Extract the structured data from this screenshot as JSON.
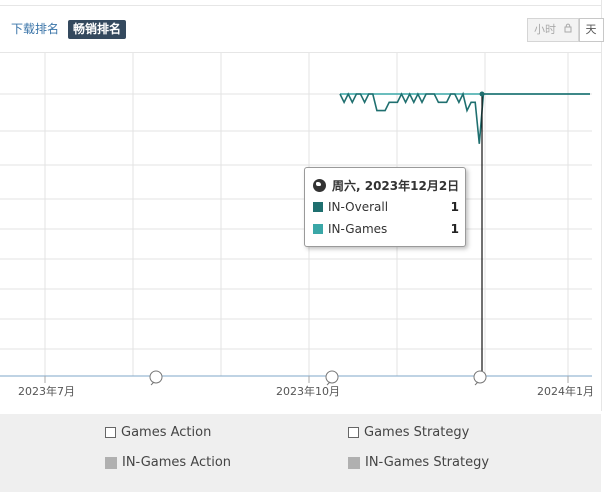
{
  "tabs": [
    {
      "label": "下载排名",
      "active": false
    },
    {
      "label": "畅销排名",
      "active": true
    }
  ],
  "granularity": {
    "hour_label": "小时",
    "lock_icon": "lock-icon",
    "day_label": "天"
  },
  "x_axis_labels": [
    "2023年7月",
    "2023年10月",
    "2024年1月"
  ],
  "tooltip": {
    "date": "周六, 2023年12月2日",
    "icon": "globe-icon",
    "rows": [
      {
        "name": "IN-Overall",
        "value": "1",
        "color": "#1f6f6f"
      },
      {
        "name": "IN-Games",
        "value": "1",
        "color": "#3aa7a7"
      }
    ]
  },
  "legend": {
    "checkbox_items": [
      "Games Action",
      "Games Strategy"
    ],
    "series_items": [
      "IN-Games Action",
      "IN-Games Strategy"
    ],
    "inactive_color": "#b0b0b0"
  },
  "chart_data": {
    "type": "line",
    "series": [
      {
        "name": "IN-Overall",
        "color": "#1f6f6f",
        "ranks": [
          1,
          2,
          1,
          2,
          1,
          1,
          2,
          1,
          1,
          3,
          3,
          3,
          2,
          2,
          2,
          1,
          2,
          1,
          2,
          1,
          2,
          1,
          1,
          1,
          2,
          2,
          2,
          1,
          1,
          2,
          1,
          3,
          2,
          2,
          7,
          1,
          1,
          1,
          1,
          1,
          1,
          1,
          1,
          1,
          1,
          1,
          1,
          1,
          1,
          1,
          1,
          1,
          1,
          1,
          1,
          1,
          1,
          1,
          1,
          1,
          1,
          1
        ]
      },
      {
        "name": "IN-Games",
        "color": "#3aa7a7",
        "ranks": [
          1,
          1,
          1,
          1,
          1,
          1,
          1,
          1,
          1,
          1,
          1,
          1,
          1,
          1,
          1,
          1,
          1,
          1,
          1,
          1,
          1,
          1,
          1,
          1,
          1,
          1,
          1,
          1,
          1,
          1,
          1,
          1,
          1,
          1,
          1,
          1,
          1,
          1,
          1,
          1,
          1,
          1,
          1,
          1,
          1,
          1,
          1,
          1,
          1,
          1,
          1,
          1,
          1,
          1,
          1,
          1,
          1,
          1,
          1,
          1,
          1,
          1
        ]
      }
    ],
    "x_tick_labels": [
      "2023年7月",
      "2023年10月",
      "2024年1月"
    ],
    "selected_date": "周六, 2023年12月2日",
    "y_axis": "rank, top = 1"
  }
}
